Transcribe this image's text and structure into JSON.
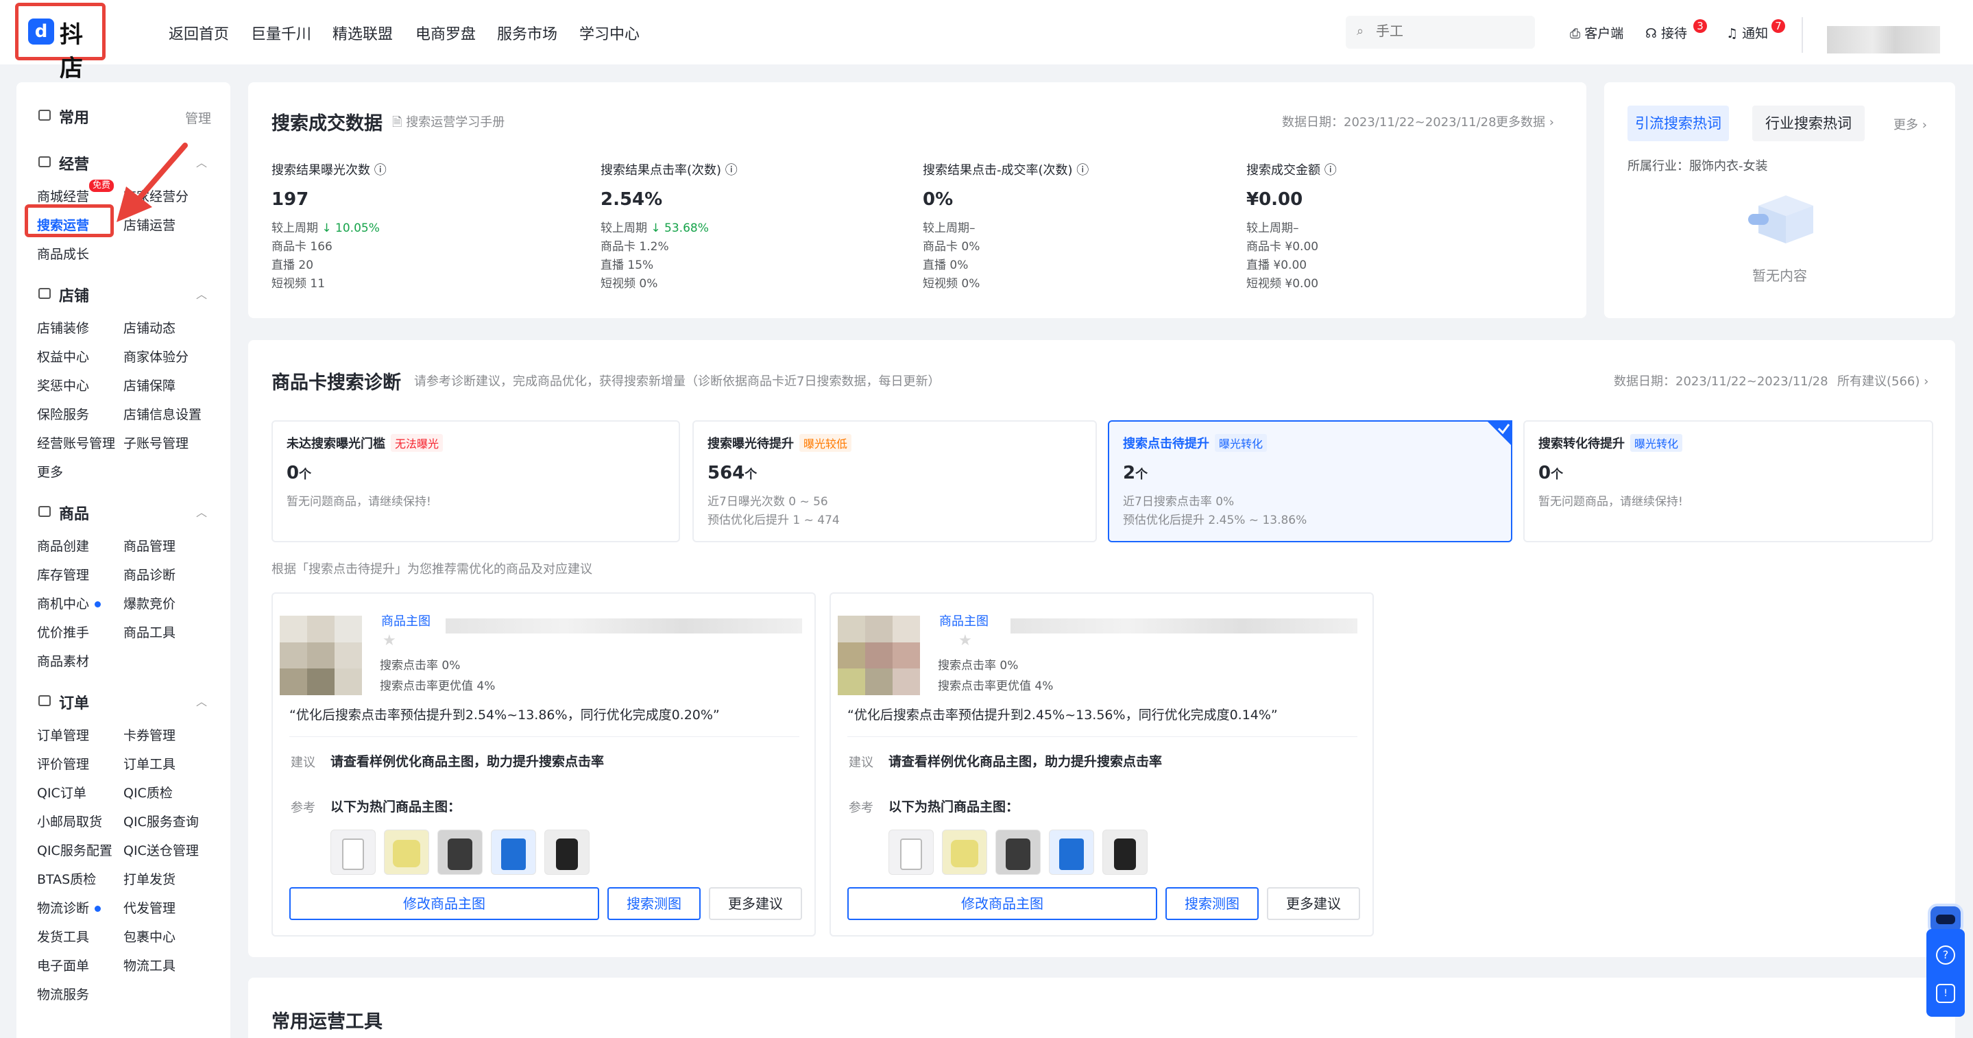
{
  "header": {
    "logo_text": "抖店",
    "logo_mark": "d",
    "nav": [
      "返回首页",
      "巨量千川",
      "精选联盟",
      "电商罗盘",
      "服务市场",
      "学习中心"
    ],
    "search_placeholder": "手工",
    "links": {
      "client": "客户端",
      "reception": "接待",
      "reception_badge": "3",
      "notice": "通知",
      "notice_badge": "7"
    }
  },
  "sidebar": {
    "common": {
      "title": "常用",
      "manage": "管理"
    },
    "business": {
      "title": "经营",
      "items": [
        "商城经营",
        "商家经营分",
        "搜索运营",
        "店铺运营",
        "商品成长"
      ],
      "badge": "免费"
    },
    "shop": {
      "title": "店铺",
      "items": [
        "店铺装修",
        "店铺动态",
        "权益中心",
        "商家体验分",
        "奖惩中心",
        "店铺保障",
        "保险服务",
        "店铺信息设置",
        "经营账号管理",
        "子账号管理",
        "更多"
      ]
    },
    "goods": {
      "title": "商品",
      "items": [
        "商品创建",
        "商品管理",
        "库存管理",
        "商品诊断",
        "商机中心",
        "爆款竞价",
        "优价推手",
        "商品工具",
        "商品素材"
      ]
    },
    "orders": {
      "title": "订单",
      "items": [
        "订单管理",
        "卡券管理",
        "评价管理",
        "订单工具",
        "QIC订单",
        "QIC质检",
        "小邮局取货",
        "QIC服务查询",
        "QIC服务配置",
        "QIC送仓管理",
        "BTAS质检",
        "打单发货",
        "物流诊断",
        "代发管理",
        "发货工具",
        "包裹中心",
        "电子面单",
        "物流工具",
        "物流服务"
      ]
    }
  },
  "search_data": {
    "title": "搜索成交数据",
    "manual": "搜索运营学习手册",
    "date_label": "数据日期：2023/11/22~2023/11/28",
    "more": "更多数据",
    "metrics": [
      {
        "label": "搜索结果曝光次数",
        "value": "197",
        "cmp": "较上周期",
        "cmp_val": "↓ 10.05%",
        "rows": [
          "商品卡 166",
          "直播 20",
          "短视频 11"
        ]
      },
      {
        "label": "搜索结果点击率(次数)",
        "value": "2.54%",
        "cmp": "较上周期",
        "cmp_val": "↓ 53.68%",
        "rows": [
          "商品卡 1.2%",
          "直播 15%",
          "短视频 0%"
        ]
      },
      {
        "label": "搜索结果点击-成交率(次数)",
        "value": "0%",
        "cmp": "较上周期–",
        "cmp_val": "",
        "rows": [
          "商品卡 0%",
          "直播 0%",
          "短视频 0%"
        ]
      },
      {
        "label": "搜索成交金额",
        "value": "¥0.00",
        "cmp": "较上周期–",
        "cmp_val": "",
        "rows": [
          "商品卡 ¥0.00",
          "直播 ¥0.00",
          "短视频 ¥0.00"
        ]
      }
    ]
  },
  "hot_words": {
    "tab1": "引流搜索热词",
    "tab2": "行业搜索热词",
    "more": "更多",
    "industry": "所属行业：服饰内衣-女装",
    "empty": "暂无内容"
  },
  "diagnosis": {
    "title": "商品卡搜索诊断",
    "desc": "请参考诊断建议，完成商品优化，获得搜索新增量（诊断依据商品卡近7日搜索数据，每日更新）",
    "date_label": "数据日期：2023/11/22~2023/11/28",
    "all": "所有建议(566)",
    "unit": "个",
    "cards": [
      {
        "title": "未达搜索曝光门槛",
        "tag": "无法曝光",
        "value": "0",
        "notes": [
          "暂无问题商品，请继续保持!"
        ]
      },
      {
        "title": "搜索曝光待提升",
        "tag": "曝光较低",
        "value": "564",
        "notes": [
          "近7日曝光次数 0 ~ 56",
          "预估优化后提升 1 ~ 474"
        ]
      },
      {
        "title": "搜索点击待提升",
        "tag": "曝光转化",
        "value": "2",
        "notes": [
          "近7日搜索点击率 0%",
          "预估优化后提升 2.45% ~ 13.86%"
        ]
      },
      {
        "title": "搜索转化待提升",
        "tag": "曝光转化",
        "value": "0",
        "notes": [
          "暂无问题商品，请继续保持!"
        ]
      }
    ],
    "recommend_text": "根据「搜索点击待提升」为您推荐需优化的商品及对应建议",
    "products": [
      {
        "link": "商品主图",
        "ctr": "搜索点击率 0%",
        "better": "搜索点击率更优值 4%",
        "quote": "“优化后搜索点击率预估提升到2.54%~13.86%，同行优化完成度0.20%”",
        "advice_label": "建议",
        "advice": "请查看样例优化商品主图，助力提升搜索点击率",
        "ref_label": "参考",
        "ref": "以下为热门商品主图：",
        "btn_edit": "修改商品主图",
        "btn_test": "搜索测图",
        "btn_more": "更多建议"
      },
      {
        "link": "商品主图",
        "ctr": "搜索点击率 0%",
        "better": "搜索点击率更优值 4%",
        "quote": "“优化后搜索点击率预估提升到2.45%~13.56%，同行优化完成度0.14%”",
        "advice_label": "建议",
        "advice": "请查看样例优化商品主图，助力提升搜索点击率",
        "ref_label": "参考",
        "ref": "以下为热门商品主图：",
        "btn_edit": "修改商品主图",
        "btn_test": "搜索测图",
        "btn_more": "更多建议"
      }
    ]
  },
  "tools": {
    "title": "常用运营工具"
  }
}
